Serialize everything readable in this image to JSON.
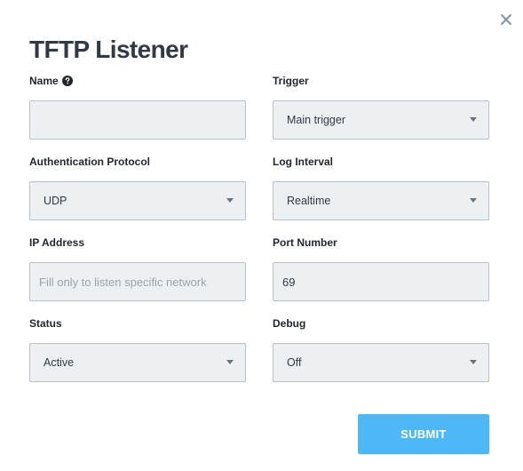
{
  "dialog": {
    "title": "TFTP Listener",
    "close_icon": "close-icon",
    "submit_label": "SUBMIT",
    "accent_color": "#4db8f5"
  },
  "fields": {
    "name": {
      "label": "Name",
      "value": "",
      "placeholder": "",
      "help_icon": "question-circle-icon"
    },
    "trigger": {
      "label": "Trigger",
      "value": "Main trigger"
    },
    "auth_protocol": {
      "label": "Authentication Protocol",
      "value": "UDP"
    },
    "log_interval": {
      "label": "Log Interval",
      "value": "Realtime"
    },
    "ip_address": {
      "label": "IP Address",
      "value": "",
      "placeholder": "Fill only to listen specific network"
    },
    "port_number": {
      "label": "Port Number",
      "value": "69"
    },
    "status": {
      "label": "Status",
      "value": "Active"
    },
    "debug": {
      "label": "Debug",
      "value": "Off"
    }
  }
}
